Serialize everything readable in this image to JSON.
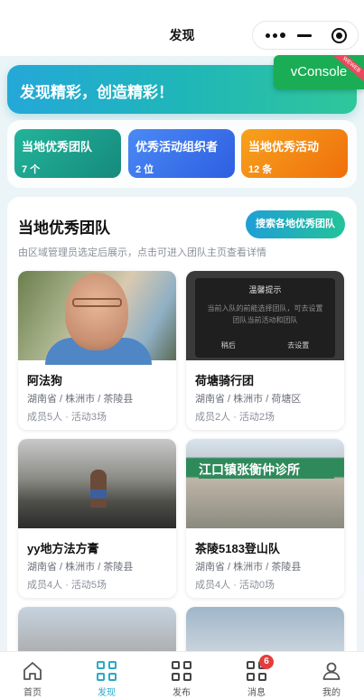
{
  "nav": {
    "title": "发现"
  },
  "vconsole": {
    "label": "vConsole",
    "ribbon": "WEWEB"
  },
  "hero": {
    "text": "发现精彩，创造精彩！"
  },
  "stats": [
    {
      "label": "当地优秀团队",
      "value": "7 个",
      "color": "#1a9e8c"
    },
    {
      "label": "优秀活动组织者",
      "value": "2 位",
      "color": "#3a6ff0"
    },
    {
      "label": "当地优秀活动",
      "value": "12 条",
      "color": "#f5860f"
    }
  ],
  "section": {
    "title": "当地优秀团队",
    "button": "搜索各地优秀团队",
    "desc": "由区域管理员选定后展示，点击可进入团队主页查看详情"
  },
  "teams": [
    {
      "name": "阿法狗",
      "location": "湖南省 / 株洲市 / 茶陵县",
      "meta": "成员5人 · 活动3场"
    },
    {
      "name": "荷塘骑行团",
      "location": "湖南省 / 株洲市 / 荷塘区",
      "meta": "成员2人 · 活动2场"
    },
    {
      "name": "yy地方法方膏",
      "location": "湖南省 / 株洲市 / 茶陵县",
      "meta": "成员4人 · 活动5场"
    },
    {
      "name": "茶陵5183登山队",
      "location": "湖南省 / 株洲市 / 茶陵县",
      "meta": "成员4人 · 活动0场"
    }
  ],
  "photo_dialog": {
    "title": "温馨提示",
    "body": "当前入队的前能选择团队，可去设置团队当前活动和团队",
    "cancel": "稍后",
    "confirm": "去设置"
  },
  "photo_sign": "江口镇张衡仲诊所",
  "tabs": [
    {
      "label": "首页",
      "icon": "home-icon"
    },
    {
      "label": "发现",
      "icon": "discover-icon",
      "active": true
    },
    {
      "label": "发布",
      "icon": "publish-icon"
    },
    {
      "label": "消息",
      "icon": "message-icon",
      "badge": "6"
    },
    {
      "label": "我的",
      "icon": "profile-icon"
    }
  ]
}
